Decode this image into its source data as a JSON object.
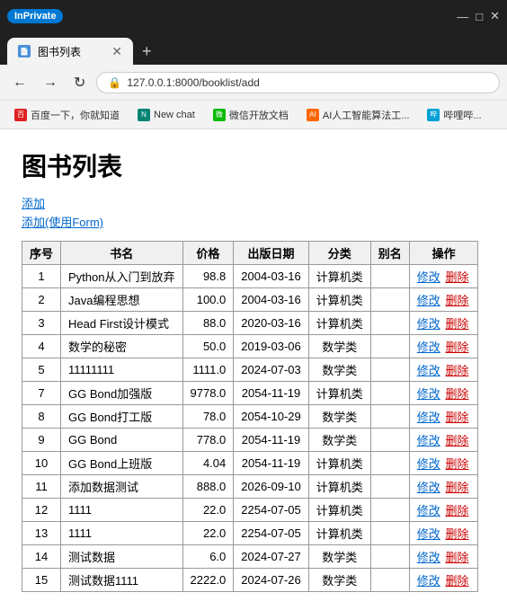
{
  "browser": {
    "inprivate_label": "InPrivate",
    "tab_title": "图书列表",
    "new_tab_icon": "+",
    "address": "127.0.0.1:8000/booklist/add",
    "back_icon": "←",
    "forward_icon": "→",
    "refresh_icon": "↻",
    "home_icon": "⌂",
    "lock_icon": "🔒",
    "bookmarks": [
      {
        "favicon_class": "bm-baidu",
        "favicon_text": "百",
        "label": "百度一下，你就知道"
      },
      {
        "favicon_class": "bm-bing",
        "favicon_text": "N",
        "label": "New chat"
      },
      {
        "favicon_class": "bm-wechat",
        "favicon_text": "微",
        "label": "微信开放文档"
      },
      {
        "favicon_class": "bm-ai",
        "favicon_text": "AI",
        "label": "AI人工智能算法工..."
      },
      {
        "favicon_class": "bm-bili",
        "favicon_text": "哔",
        "label": "哔哩哔..."
      }
    ]
  },
  "page": {
    "title": "图书列表",
    "link_add": "添加",
    "link_add_form": "添加(使用Form)",
    "table": {
      "headers": [
        "序号",
        "书名",
        "价格",
        "出版日期",
        "分类",
        "别名",
        "操作"
      ],
      "rows": [
        {
          "id": "1",
          "name": "Python从入门到放弃",
          "price": "98.8",
          "date": "2004-03-16",
          "category": "计算机类",
          "alias": "",
          "edit": "修改",
          "delete": "删除"
        },
        {
          "id": "2",
          "name": "Java编程思想",
          "price": "100.0",
          "date": "2004-03-16",
          "category": "计算机类",
          "alias": "",
          "edit": "修改",
          "delete": "删除"
        },
        {
          "id": "3",
          "name": "Head First设计模式",
          "price": "88.0",
          "date": "2020-03-16",
          "category": "计算机类",
          "alias": "",
          "edit": "修改",
          "delete": "删除"
        },
        {
          "id": "4",
          "name": "数学的秘密",
          "price": "50.0",
          "date": "2019-03-06",
          "category": "数学类",
          "alias": "",
          "edit": "修改",
          "delete": "删除"
        },
        {
          "id": "5",
          "name": "11111111",
          "price": "1111.0",
          "date": "2024-07-03",
          "category": "数学类",
          "alias": "",
          "edit": "修改",
          "delete": "删除"
        },
        {
          "id": "7",
          "name": "GG Bond加强版",
          "price": "9778.0",
          "date": "2054-11-19",
          "category": "计算机类",
          "alias": "",
          "edit": "修改",
          "delete": "删除"
        },
        {
          "id": "8",
          "name": "GG Bond打工版",
          "price": "78.0",
          "date": "2054-10-29",
          "category": "数学类",
          "alias": "",
          "edit": "修改",
          "delete": "删除"
        },
        {
          "id": "9",
          "name": "GG Bond",
          "price": "778.0",
          "date": "2054-11-19",
          "category": "数学类",
          "alias": "",
          "edit": "修改",
          "delete": "删除"
        },
        {
          "id": "10",
          "name": "GG Bond上班版",
          "price": "4.04",
          "date": "2054-11-19",
          "category": "计算机类",
          "alias": "",
          "edit": "修改",
          "delete": "删除"
        },
        {
          "id": "11",
          "name": "添加数据测试",
          "price": "888.0",
          "date": "2026-09-10",
          "category": "计算机类",
          "alias": "",
          "edit": "修改",
          "delete": "删除"
        },
        {
          "id": "12",
          "name": "1111",
          "price": "22.0",
          "date": "2254-07-05",
          "category": "计算机类",
          "alias": "",
          "edit": "修改",
          "delete": "删除"
        },
        {
          "id": "13",
          "name": "1111",
          "price": "22.0",
          "date": "2254-07-05",
          "category": "计算机类",
          "alias": "",
          "edit": "修改",
          "delete": "删除"
        },
        {
          "id": "14",
          "name": "测试数据",
          "price": "6.0",
          "date": "2024-07-27",
          "category": "数学类",
          "alias": "",
          "edit": "修改",
          "delete": "删除"
        },
        {
          "id": "15",
          "name": "测试数据1111",
          "price": "2222.0",
          "date": "2024-07-26",
          "category": "数学类",
          "alias": "",
          "edit": "修改",
          "delete": "删除"
        }
      ]
    }
  }
}
